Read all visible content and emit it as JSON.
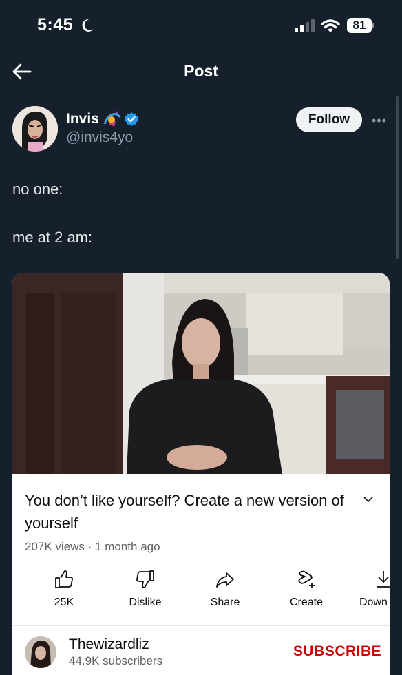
{
  "status_bar": {
    "time": "5:45",
    "battery": "81"
  },
  "header": {
    "title": "Post"
  },
  "author": {
    "name": "Invis",
    "handle": "@invis4yo",
    "follow_label": "Follow"
  },
  "post": {
    "line1": "no one:",
    "line2": "me at 2 am:"
  },
  "embed": {
    "title": "You don’t like yourself? Create a new version of yourself",
    "meta": "207K views · 1 month ago",
    "actions": [
      {
        "label": "25K",
        "icon": "like-icon"
      },
      {
        "label": "Dislike",
        "icon": "dislike-icon"
      },
      {
        "label": "Share",
        "icon": "share-icon"
      },
      {
        "label": "Create",
        "icon": "create-icon"
      },
      {
        "label": "Down",
        "icon": "download-icon"
      }
    ],
    "channel": {
      "name": "Thewizardliz",
      "subscribers": "44.9K subscribers",
      "subscribe_label": "SUBSCRIBE"
    }
  },
  "colors": {
    "background": "#16202d",
    "verified": "#1d9bf0",
    "subscribe": "#cc0000"
  }
}
